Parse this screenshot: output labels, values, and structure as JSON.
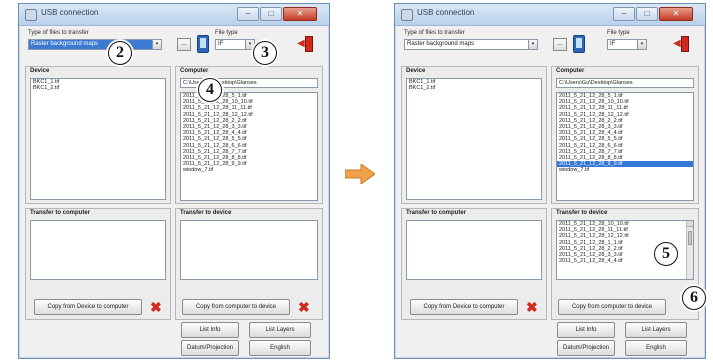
{
  "window": {
    "title": "USB connection",
    "minimize": "–",
    "maximize": "□",
    "close": "✕"
  },
  "type_label": "Type of files to transfer",
  "type_value": "Raster background maps",
  "type_arrow": "▾",
  "browse": "...",
  "filetype_label": "File type",
  "filetype_value": "IF",
  "groups": {
    "device": "Device",
    "computer": "Computer",
    "transfer_to_computer": "Transfer to computer",
    "transfer_to_device": "Transfer to device"
  },
  "device_items": [
    "BKC1_1.tif",
    "BKC1_2.tif"
  ],
  "computer_path": "C:\\Users\\Gu\\Desktop\\Glanses",
  "computer_items_left": [
    "2011_5_21_12_28_5_1.tif",
    "2011_5_21_12_28_10_10.tif",
    "2011_5_21_12_28_11_11.tif",
    "2011_5_21_12_28_12_12.tif",
    "2011_5_21_12_28_2_2.tif",
    "2011_5_21_12_28_3_3.tif",
    "2011_5_21_12_28_4_4.tif",
    "2011_5_21_12_28_5_5.tif",
    "2011_5_21_12_28_6_6.tif",
    "2011_5_21_12_28_7_7.tif",
    "2011_5_21_12_28_8_8.tif",
    "2011_5_21_12_28_9_9.tif",
    "window_7.tif"
  ],
  "computer_items_right": [
    "2011_5_21_12_28_5_1.tif",
    "2011_5_21_12_28_10_10.tif",
    "2011_5_21_12_28_11_11.tif",
    "2011_5_21_12_28_12_12.tif",
    "2011_5_21_12_28_2_2.tif",
    "2011_5_21_12_28_3_3.tif",
    "2011_5_21_12_28_4_4.tif",
    "2011_5_21_12_28_5_5.tif",
    "2011_5_21_12_28_6_6.tif",
    "2011_5_21_12_28_7_7.tif",
    "2011_5_21_12_28_8_8.tif",
    "2011_5_21_12_28_9_9.tif",
    "window_7.tif"
  ],
  "transfer_device_items": [
    "2011_5_21_12_28_10_10.tif",
    "2011_5_21_12_28_11_11.tif",
    "2011_5_21_12_28_12_12.tif",
    "2011_5_21_12_28_1_1.tif",
    "2011_5_21_12_28_2_2.tif",
    "2011_5_21_12_28_3_3.tif",
    "2011_5_21_12_28_4_4.tif"
  ],
  "buttons": {
    "copy_from_device": "Copy from Device to computer",
    "copy_from_computer": "Copy from computer to device",
    "list_info": "List Info",
    "list_layers": "List Layers",
    "datum": "Datum/Projection",
    "language": "English",
    "delete": "✖"
  },
  "callouts": {
    "c2": "2",
    "c3": "3",
    "c4": "4",
    "c5": "5",
    "c6": "6"
  },
  "colors": {
    "arrow": "#f0a24a",
    "delete": "#d12a1f",
    "selection": "#3477d6"
  }
}
